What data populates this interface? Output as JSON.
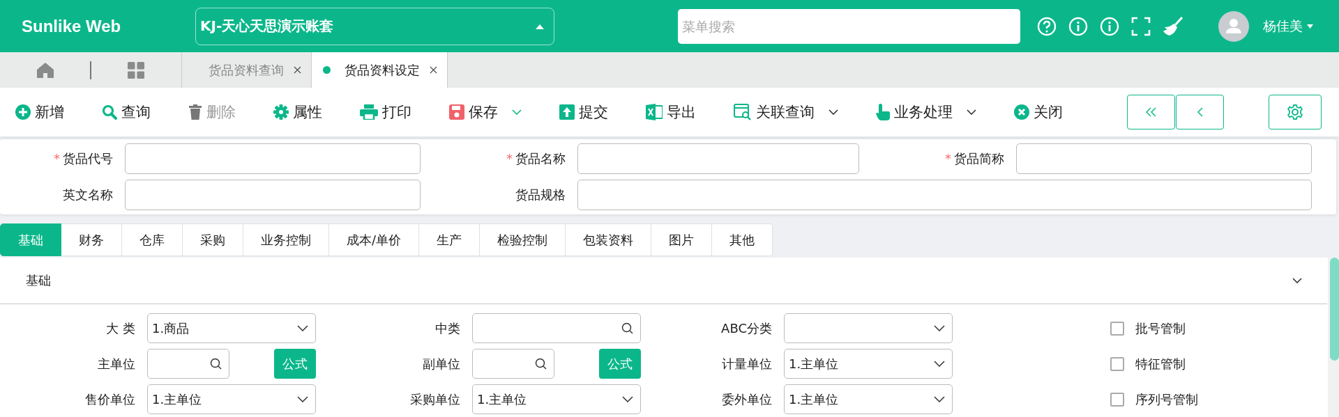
{
  "header": {
    "logo": "Sunlike Web",
    "account": "KJ-天心天思演示账套",
    "search": {
      "placeholder": "菜单搜索"
    },
    "user": "杨佳美"
  },
  "tabs": [
    {
      "label": "货品资料查询",
      "selected": false
    },
    {
      "label": "货品资料设定",
      "selected": true
    }
  ],
  "toolbar": [
    {
      "label": "新增",
      "kind": "add",
      "disabled": false,
      "dropdown": false
    },
    {
      "label": "查询",
      "kind": "search",
      "disabled": false,
      "dropdown": false
    },
    {
      "label": "删除",
      "kind": "delete",
      "disabled": true,
      "dropdown": false
    },
    {
      "label": "属性",
      "kind": "gear",
      "disabled": false,
      "dropdown": false
    },
    {
      "label": "打印",
      "kind": "print",
      "disabled": false,
      "dropdown": false
    },
    {
      "label": "保存",
      "kind": "save",
      "disabled": false,
      "dropdown": true
    },
    {
      "label": "提交",
      "kind": "submit",
      "disabled": false,
      "dropdown": false
    },
    {
      "label": "导出",
      "kind": "excel",
      "disabled": false,
      "dropdown": false
    },
    {
      "label": "关联查询",
      "kind": "related",
      "disabled": false,
      "dropdown": true
    },
    {
      "label": "业务处理",
      "kind": "hand",
      "disabled": false,
      "dropdown": true
    },
    {
      "label": "关闭",
      "kind": "close",
      "disabled": false,
      "dropdown": false
    }
  ],
  "required_mark": "*",
  "header_fields": [
    {
      "label": "货品代号",
      "required": true
    },
    {
      "label": "货品名称",
      "required": true
    },
    {
      "label": "货品简称",
      "required": true
    },
    {
      "label": "英文名称",
      "required": false
    },
    {
      "label": "货品规格",
      "required": false
    }
  ],
  "section_tabs": [
    {
      "label": "基础",
      "selected": true
    },
    {
      "label": "财务",
      "selected": false
    },
    {
      "label": "仓库",
      "selected": false
    },
    {
      "label": "采购",
      "selected": false
    },
    {
      "label": "业务控制",
      "selected": false
    },
    {
      "label": "成本/单价",
      "selected": false
    },
    {
      "label": "生产",
      "selected": false
    },
    {
      "label": "检验控制",
      "selected": false
    },
    {
      "label": "包装资料",
      "selected": false
    },
    {
      "label": "图片",
      "selected": false
    },
    {
      "label": "其他",
      "selected": false
    }
  ],
  "section": {
    "title": "基础",
    "expanded": true
  },
  "fields": [
    [
      {
        "label": "大 类",
        "kind": "select",
        "value": "1.商品"
      },
      {
        "label": "中类",
        "kind": "search"
      },
      {
        "label": "ABC分类",
        "kind": "select"
      },
      {
        "label": "批号管制",
        "kind": "checkbox",
        "checked": false
      }
    ],
    [
      {
        "label": "主单位",
        "kind": "search",
        "formula": "公式"
      },
      {
        "label": "副单位",
        "kind": "search",
        "formula": "公式"
      },
      {
        "label": "计量单位",
        "kind": "select",
        "value": "1.主单位"
      },
      {
        "label": "特征管制",
        "kind": "checkbox",
        "checked": false
      }
    ],
    [
      {
        "label": "售价单位",
        "kind": "select",
        "value": "1.主单位"
      },
      {
        "label": "采购单位",
        "kind": "select",
        "value": "1.主单位"
      },
      {
        "label": "委外单位",
        "kind": "select",
        "value": "1.主单位"
      },
      {
        "label": "序列号管制",
        "kind": "checkbox",
        "checked": false
      }
    ]
  ]
}
